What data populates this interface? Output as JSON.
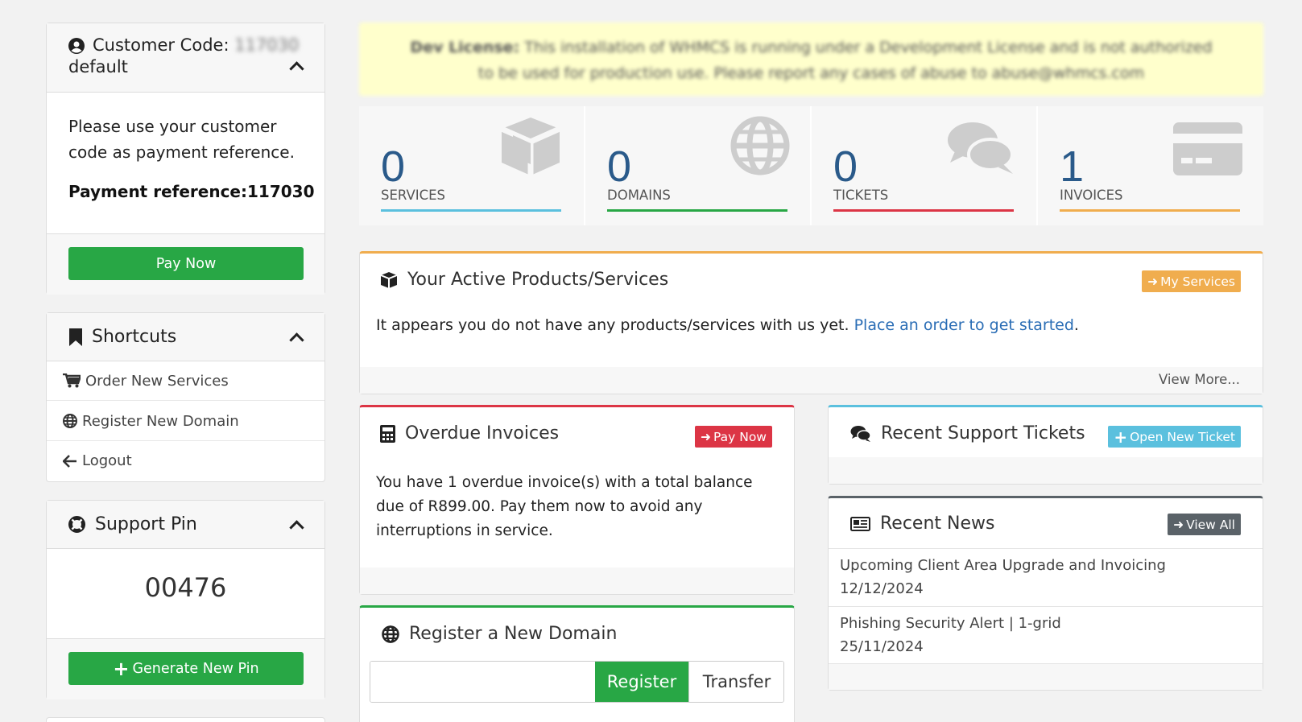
{
  "sidebar": {
    "customer": {
      "title_prefix": "Customer Code:",
      "code": "117030",
      "title_suffix": "default",
      "message": "Please use your customer code as payment reference.",
      "payment_reference": "Payment reference:117030",
      "pay_button": "Pay Now"
    },
    "shortcuts": {
      "title": "Shortcuts",
      "items": [
        {
          "label": "Order New Services",
          "icon": "cart-icon"
        },
        {
          "label": "Register New Domain",
          "icon": "globe-icon"
        },
        {
          "label": "Logout",
          "icon": "arrow-left-icon"
        }
      ]
    },
    "support_pin": {
      "title": "Support Pin",
      "pin": "00476",
      "generate_button": "Generate New Pin"
    }
  },
  "dev_license": {
    "label": "Dev License:",
    "text": "This installation of WHMCS is running under a Development License and is not authorized to be used for production use. Please report any cases of abuse to abuse@whmcs.com"
  },
  "stats": [
    {
      "value": "0",
      "label": "SERVICES",
      "color": "#5bc0de",
      "icon": "cube-icon"
    },
    {
      "value": "0",
      "label": "DOMAINS",
      "color": "#28a745",
      "icon": "globe-icon"
    },
    {
      "value": "0",
      "label": "TICKETS",
      "color": "#dc3545",
      "icon": "comments-icon"
    },
    {
      "value": "1",
      "label": "INVOICES",
      "color": "#f0ad4e",
      "icon": "credit-card-icon"
    }
  ],
  "active_products": {
    "title": "Your Active Products/Services",
    "button": "My Services",
    "message": "It appears you do not have any products/services with us yet.",
    "link": "Place an order to get started",
    "link_suffix": ".",
    "view_more": "View More..."
  },
  "overdue": {
    "title": "Overdue Invoices",
    "button": "Pay Now",
    "message": "You have 1 overdue invoice(s) with a total balance due of R899.00. Pay them now to avoid any interruptions in service."
  },
  "tickets": {
    "title": "Recent Support Tickets",
    "button": "Open New Ticket"
  },
  "news": {
    "title": "Recent News",
    "button": "View All",
    "items": [
      {
        "title": "Upcoming Client Area Upgrade and Invoicing",
        "date": "12/12/2024"
      },
      {
        "title": "Phishing Security Alert | 1-grid",
        "date": "25/11/2024"
      }
    ]
  },
  "register_domain": {
    "title": "Register a New Domain",
    "input_placeholder": "",
    "register_button": "Register",
    "transfer_button": "Transfer"
  },
  "colors": {
    "green": "#28a745",
    "orange": "#f0ad4e",
    "red": "#dc3545",
    "blue": "#5bc0de",
    "link": "#2a6db5",
    "gray": "#5a6268"
  }
}
